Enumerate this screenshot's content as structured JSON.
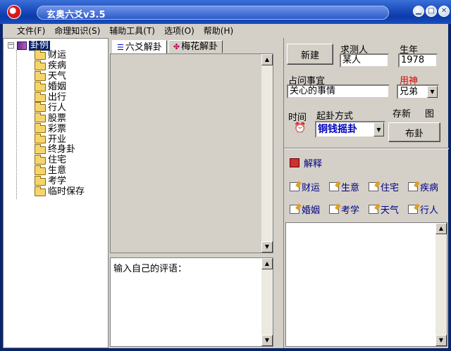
{
  "window": {
    "title": "玄奥六爻v3.5"
  },
  "menu": [
    "文件(F)",
    "命理知识(S)",
    "辅助工具(T)",
    "选项(O)",
    "帮助(H)"
  ],
  "tree": {
    "root": "卦例",
    "items": [
      "财运",
      "疾病",
      "天气",
      "婚姻",
      "出行",
      "行人",
      "股票",
      "彩票",
      "开业",
      "终身卦",
      "住宅",
      "生意",
      "考学",
      "临时保存"
    ]
  },
  "tabs": [
    "六爻解卦",
    "梅花解卦"
  ],
  "comment": {
    "prompt": "输入自己的评语："
  },
  "form": {
    "new_button": "新建",
    "asker_label": "求测人",
    "asker_value": "某人",
    "birth_year_label": "生年",
    "birth_year_value": "1978",
    "matter_label": "占问事宜",
    "matter_value": "关心的事情",
    "yongshen_label": "用神",
    "yongshen_value": "兄弟",
    "time_label": "时间",
    "method_label": "起卦方式",
    "method_value": "铜钱摇卦",
    "save_new_label": "存新",
    "picture_label": "图",
    "cast_button": "布卦"
  },
  "interpret": {
    "label": "解释",
    "topics": [
      "财运",
      "生意",
      "住宅",
      "疾病",
      "婚姻",
      "考学",
      "天气",
      "行人"
    ]
  },
  "colors": {
    "titlebar": "#1d4fbf",
    "face": "#d4d0c8",
    "yongshen_label": "#e00000",
    "method_text": "#0000c0"
  }
}
